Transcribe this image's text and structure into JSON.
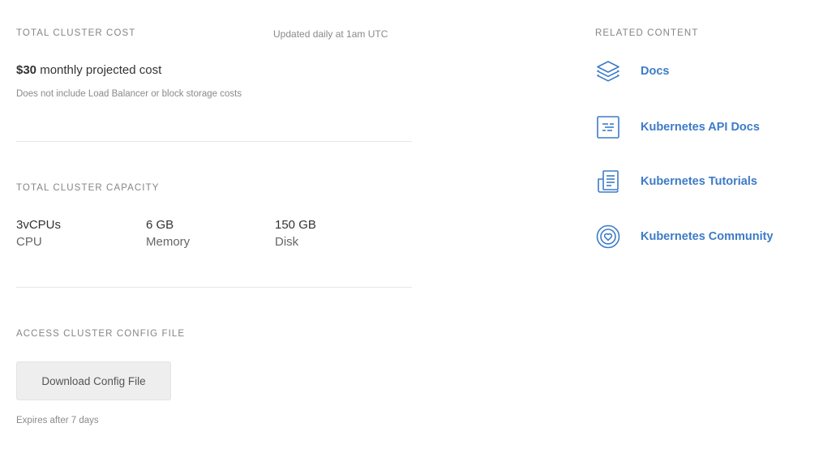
{
  "cost": {
    "section_title": "TOTAL CLUSTER COST",
    "update_note": "Updated daily at 1am UTC",
    "amount": "$30",
    "amount_suffix": "monthly projected cost",
    "note": "Does not include Load Balancer or block storage costs"
  },
  "capacity": {
    "section_title": "TOTAL CLUSTER CAPACITY",
    "items": [
      {
        "value": "3vCPUs",
        "unit": "CPU"
      },
      {
        "value": "6 GB",
        "unit": "Memory"
      },
      {
        "value": "150 GB",
        "unit": "Disk"
      }
    ]
  },
  "config": {
    "section_title": "ACCESS CLUSTER CONFIG FILE",
    "button_label": "Download Config File",
    "expiry_note": "Expires after 7 days"
  },
  "related": {
    "section_title": "RELATED CONTENT",
    "items": [
      {
        "label": "Docs",
        "icon": "layers-icon"
      },
      {
        "label": "Kubernetes API Docs",
        "icon": "api-doc-icon"
      },
      {
        "label": "Kubernetes Tutorials",
        "icon": "tutorial-icon"
      },
      {
        "label": "Kubernetes Community",
        "icon": "community-icon"
      }
    ]
  },
  "colors": {
    "link": "#3d7bc7",
    "label_gray": "#858585",
    "button_bg": "#eeeeee"
  }
}
